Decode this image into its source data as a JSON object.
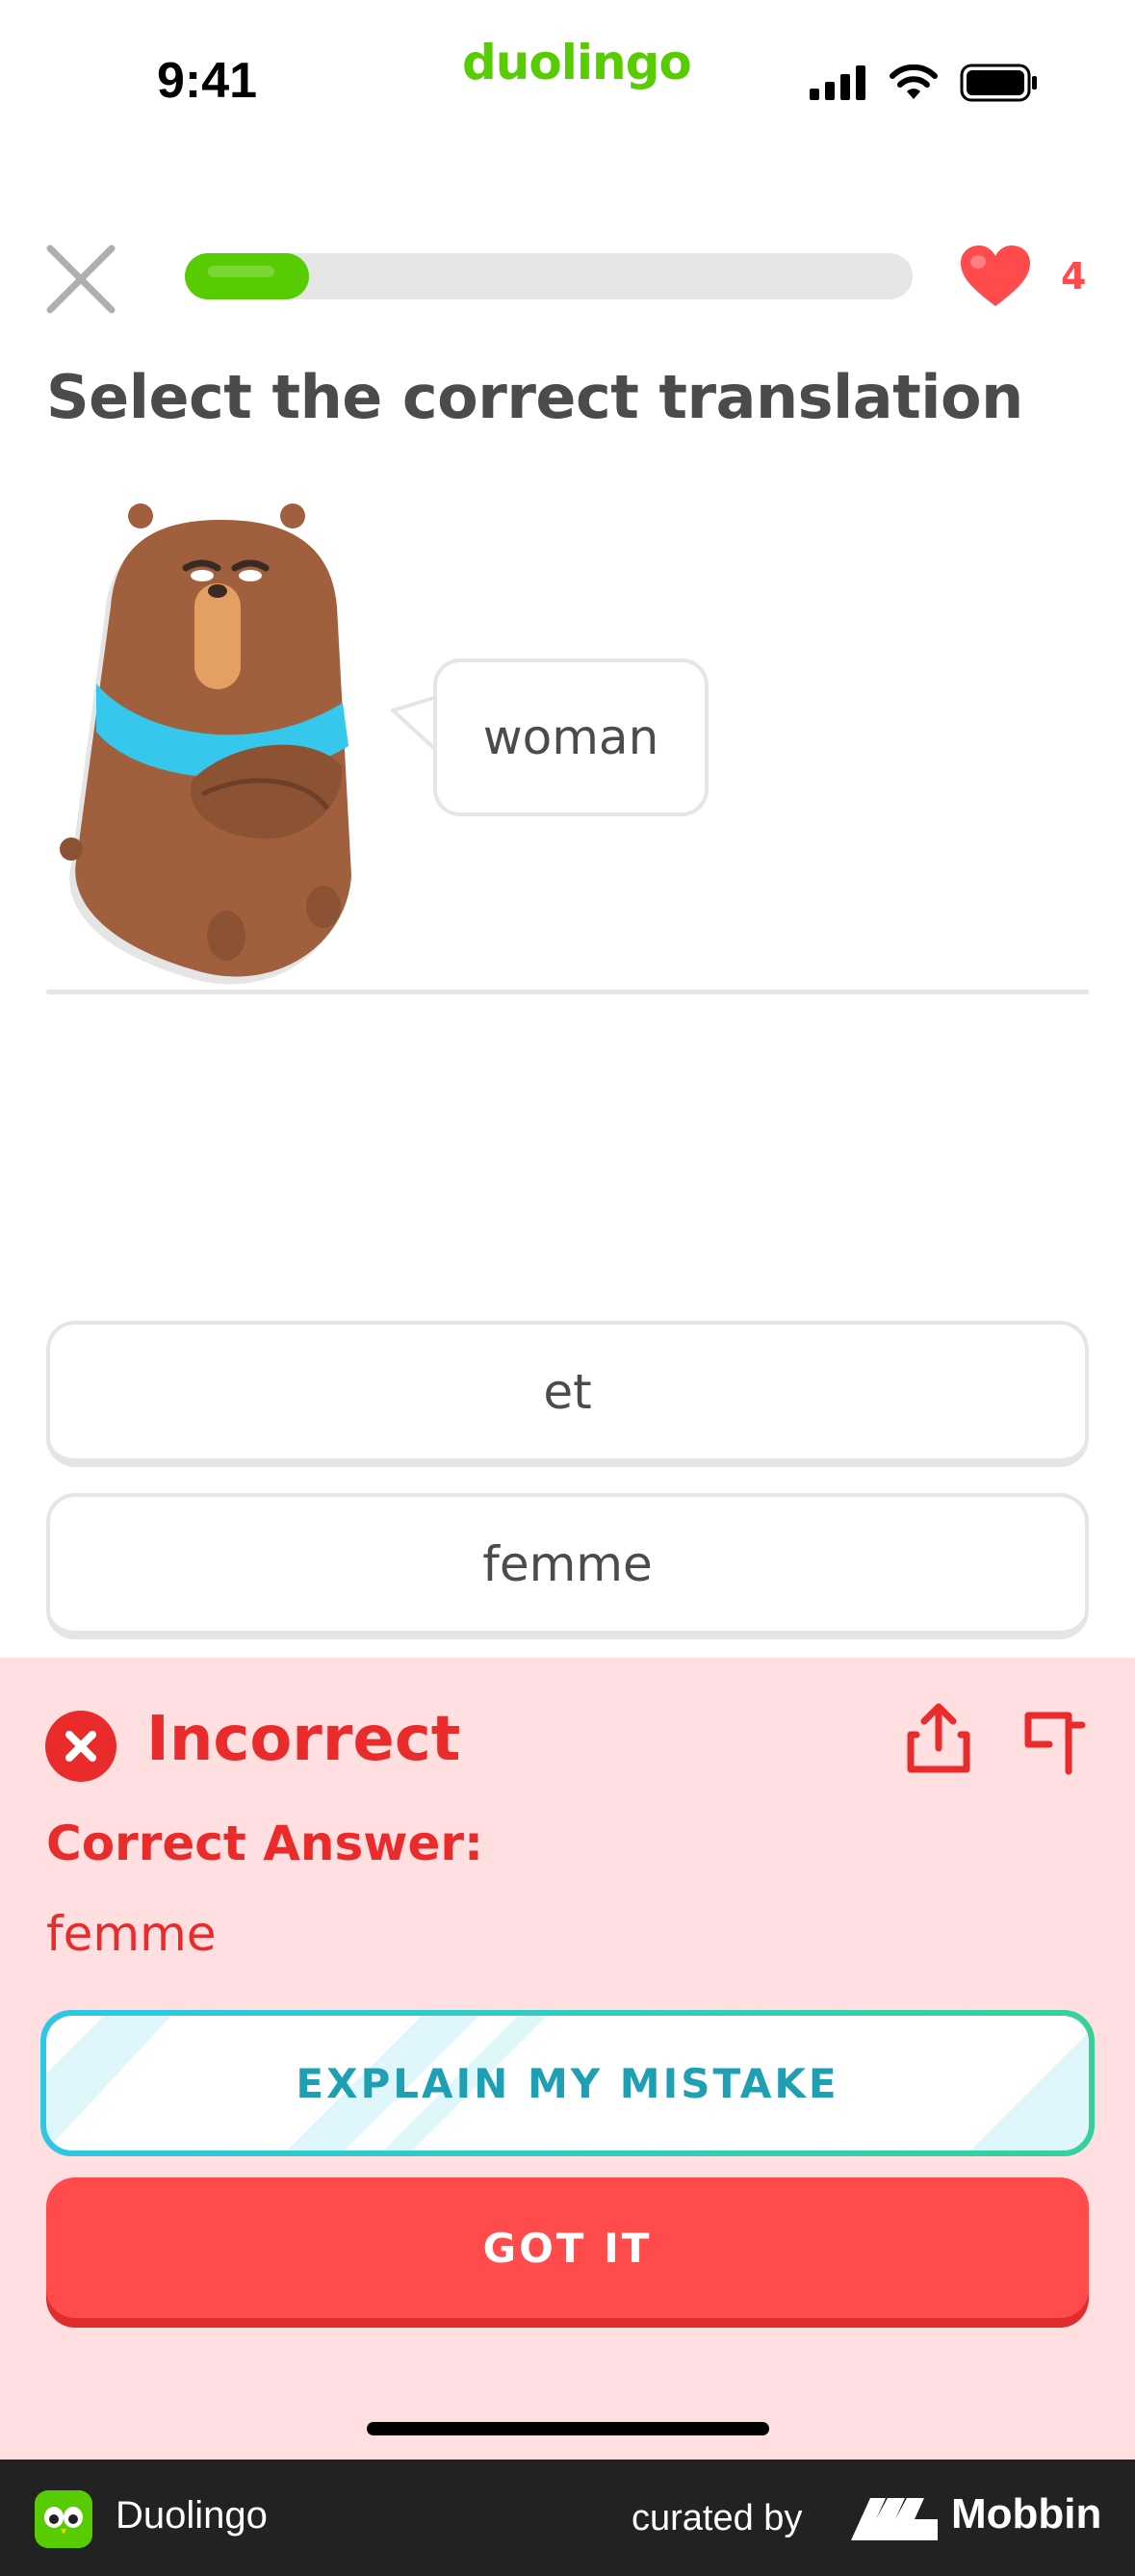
{
  "status_bar": {
    "time": "9:41",
    "brand": "duolingo",
    "icons": [
      "signal-icon",
      "wifi-icon",
      "battery-icon"
    ]
  },
  "lesson": {
    "progress": 0.17,
    "hearts": "4",
    "instruction": "Select the correct translation",
    "prompt_word": "woman"
  },
  "options": [
    {
      "label": "et"
    },
    {
      "label": "femme"
    }
  ],
  "feedback": {
    "status": "Incorrect",
    "correct_label": "Correct Answer:",
    "correct_answer": "femme",
    "explain_button": "EXPLAIN MY MISTAKE",
    "continue_button": "GOT IT"
  },
  "footer": {
    "app_name": "Duolingo",
    "curated_by": "curated by",
    "brand": "Mobbin"
  },
  "colors": {
    "green": "#58cc02",
    "red": "#ff4b4b",
    "incorrect_bg": "#ffdfe0",
    "incorrect_text": "#ea2b2b"
  }
}
